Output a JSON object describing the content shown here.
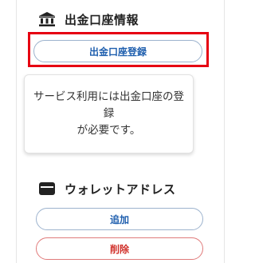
{
  "withdrawal_account": {
    "section_title": "出金口座情報",
    "icon": "bank-icon",
    "register_button_label": "出金口座登録",
    "notice_text": "サービス利用には出金口座の登録\nが必要です。"
  },
  "wallet": {
    "section_title": "ウォレットアドレス",
    "icon": "wallet-icon",
    "add_button_label": "追加",
    "delete_button_label": "削除"
  },
  "colors": {
    "highlight": "#e60012",
    "primary_text": "#1f5fae",
    "danger_text": "#d0302a"
  }
}
